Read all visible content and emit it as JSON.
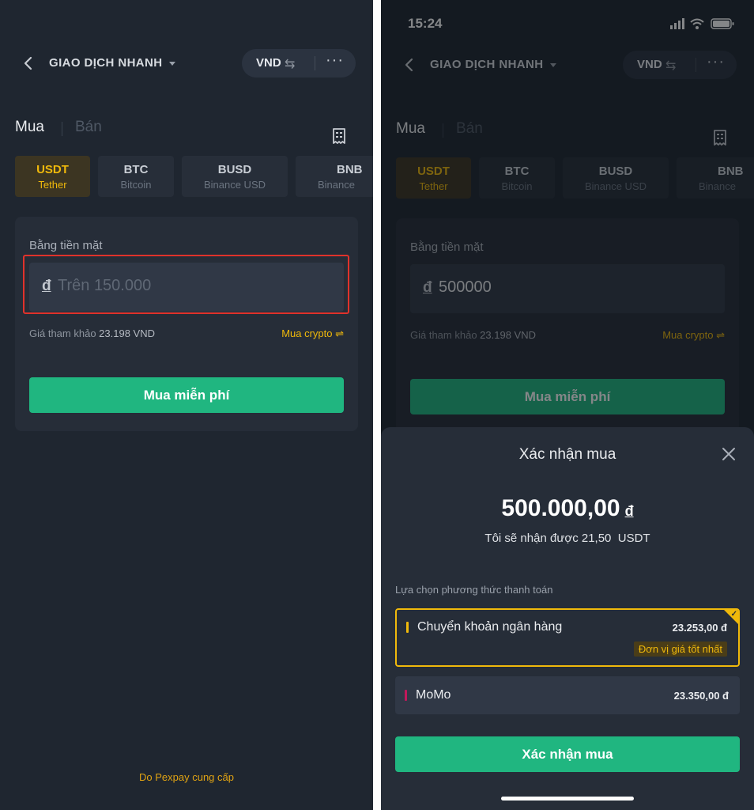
{
  "left": {
    "header": {
      "title": "GIAO DỊCH NHANH",
      "currency": "VND"
    },
    "tabs": {
      "buy": "Mua",
      "sell": "Bán"
    },
    "coins": [
      {
        "symbol": "USDT",
        "name": "Tether"
      },
      {
        "symbol": "BTC",
        "name": "Bitcoin"
      },
      {
        "symbol": "BUSD",
        "name": "Binance USD"
      },
      {
        "symbol": "BNB",
        "name": "Binance"
      }
    ],
    "form": {
      "label": "Bằng tiền mặt",
      "currency_symbol": "đ",
      "placeholder": "Trên 150.000",
      "ref_label": "Giá tham khảo",
      "ref_value": "23.198 VND",
      "mode_toggle": "Mua crypto ⇌",
      "buy_button": "Mua miễn phí"
    },
    "provider": "Do Pexpay cung cấp"
  },
  "right": {
    "status": {
      "time": "15:24"
    },
    "header": {
      "title": "GIAO DỊCH NHANH",
      "currency": "VND"
    },
    "tabs": {
      "buy": "Mua",
      "sell": "Bán"
    },
    "coins": [
      {
        "symbol": "USDT",
        "name": "Tether"
      },
      {
        "symbol": "BTC",
        "name": "Bitcoin"
      },
      {
        "symbol": "BUSD",
        "name": "Binance USD"
      },
      {
        "symbol": "BNB",
        "name": "Binance"
      }
    ],
    "form": {
      "label": "Bằng tiền mặt",
      "currency_symbol": "đ",
      "value": "500000",
      "ref_label": "Giá tham khảo",
      "ref_value": "23.198 VND",
      "mode_toggle": "Mua crypto ⇌",
      "buy_button": "Mua miễn phí"
    },
    "sheet": {
      "title": "Xác nhận mua",
      "amount": "500.000,00",
      "amount_currency": "đ",
      "receive_text": "Tôi sẽ nhận được 21,50  USDT",
      "methods_label": "Lựa chọn phương thức thanh toán",
      "methods": [
        {
          "name": "Chuyển khoản ngân hàng",
          "price": "23.253,00 đ",
          "tag": "Đơn vị giá tốt nhất",
          "accent": "#f0b90b"
        },
        {
          "name": "MoMo",
          "price": "23.350,00 đ",
          "accent": "#c2185b"
        }
      ],
      "confirm_button": "Xác nhận mua"
    }
  },
  "colors": {
    "accent": "#f0b90b",
    "primary_green": "#20b680",
    "background": "#1f2630",
    "highlight_red": "#e0322b"
  }
}
